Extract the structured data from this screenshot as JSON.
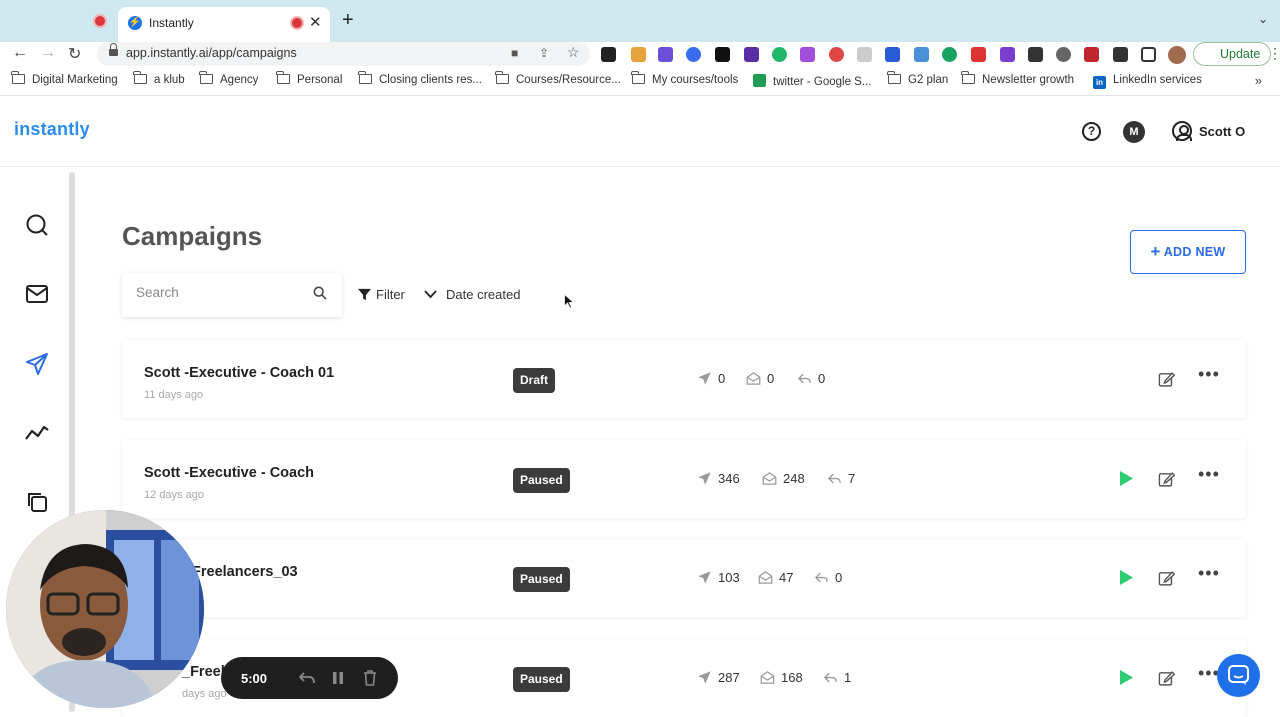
{
  "browser": {
    "tab": {
      "title": "Instantly",
      "favicon": "instantly-icon"
    },
    "url": "app.instantly.ai/app/campaigns",
    "update_label": "Update",
    "bookmarks": [
      {
        "label": "Digital Marketing",
        "icon": "folder-icon"
      },
      {
        "label": "a klub",
        "icon": "folder-icon"
      },
      {
        "label": "Agency",
        "icon": "folder-icon"
      },
      {
        "label": "Personal",
        "icon": "folder-icon"
      },
      {
        "label": "Closing clients res...",
        "icon": "folder-icon"
      },
      {
        "label": "Courses/Resource...",
        "icon": "folder-icon"
      },
      {
        "label": "My courses/tools",
        "icon": "folder-icon"
      },
      {
        "label": "twitter - Google S...",
        "icon": "sheets-icon"
      },
      {
        "label": "G2 plan",
        "icon": "folder-icon"
      },
      {
        "label": "Newsletter growth",
        "icon": "folder-icon"
      },
      {
        "label": "LinkedIn services",
        "icon": "linkedin-icon"
      }
    ]
  },
  "app": {
    "logo": "instantly",
    "workspace_initial": "M",
    "user_name": "Scott O"
  },
  "page": {
    "title": "Campaigns",
    "add_new_label": "ADD NEW",
    "search_placeholder": "Search",
    "filter_label": "Filter",
    "sort_label": "Date created"
  },
  "campaigns": [
    {
      "name": "Scott -Executive - Coach 01",
      "age": "11 days ago",
      "status": "Draft",
      "sent": "0",
      "opened": "0",
      "replied": "0",
      "playable": false
    },
    {
      "name": "Scott -Executive - Coach",
      "age": "12 days ago",
      "status": "Paused",
      "sent": "346",
      "opened": "248",
      "replied": "7",
      "playable": true
    },
    {
      "name": "Freelancers_03",
      "age": "",
      "status": "Paused",
      "sent": "103",
      "opened": "47",
      "replied": "0",
      "playable": true
    },
    {
      "name": "_Freel",
      "age": "days ago",
      "status": "Paused",
      "sent": "287",
      "opened": "168",
      "replied": "1",
      "playable": true
    }
  ],
  "recorder": {
    "time": "5:00"
  },
  "colors": {
    "accent": "#2b6be6",
    "logo": "#2b8cf0",
    "play": "#2ecc71",
    "badge": "#3b3b3b"
  }
}
